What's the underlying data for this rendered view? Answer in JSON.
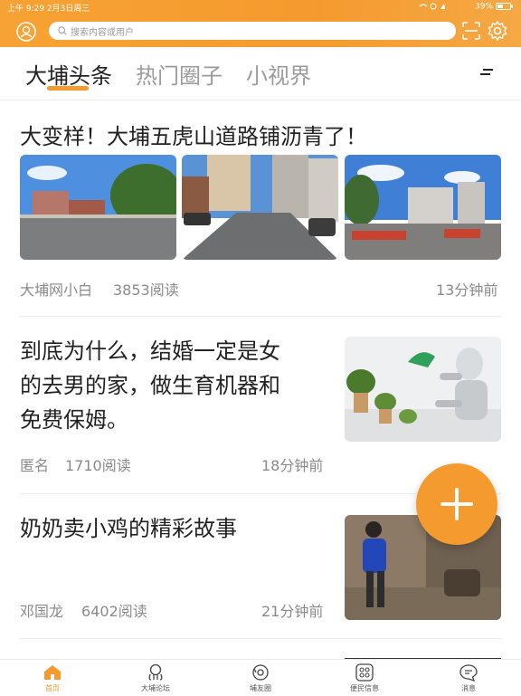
{
  "status": {
    "time": "上午 9:29",
    "date": "2月3日周三",
    "battery": "39%"
  },
  "search": {
    "placeholder": "搜索内容或用户"
  },
  "tabs": [
    {
      "label": "大埔头条",
      "active": true
    },
    {
      "label": "热门圈子",
      "active": false
    },
    {
      "label": "小视界",
      "active": false
    }
  ],
  "articles": [
    {
      "title": "大变样！大埔五虎山道路铺沥青了！",
      "author": "大埔网小白",
      "reads": "3853阅读",
      "time": "13分钟前"
    },
    {
      "title_lines": [
        "到底为什么，结婚一定是女",
        "的去男的家，做生育机器和",
        "免费保姆。"
      ],
      "author": "匿名",
      "reads": "1710阅读",
      "time": "18分钟前"
    },
    {
      "title": "奶奶卖小鸡的精彩故事",
      "author": "邓国龙",
      "reads": "6402阅读",
      "time": "21分钟前"
    }
  ],
  "bottom_nav": [
    {
      "label": "首页",
      "icon": "home-icon",
      "active": true
    },
    {
      "label": "大埔论坛",
      "icon": "forum-icon",
      "active": false
    },
    {
      "label": "埔友圈",
      "icon": "friends-circle-icon",
      "active": false
    },
    {
      "label": "便民信息",
      "icon": "services-grid-icon",
      "active": false
    },
    {
      "label": "消息",
      "icon": "message-icon",
      "active": false
    }
  ],
  "colors": {
    "accent": "#f59a2e",
    "header_gradient_start": "#f7a234",
    "text_primary": "#222222",
    "text_meta": "#8a8a8a"
  }
}
